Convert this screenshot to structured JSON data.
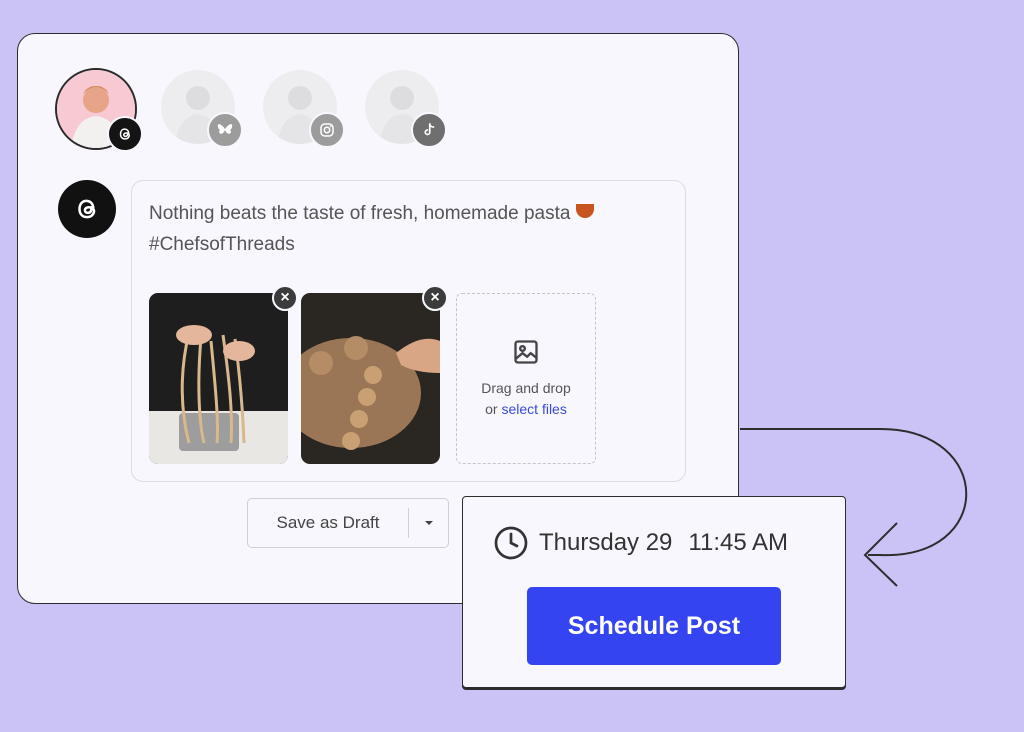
{
  "accounts": [
    {
      "name": "threads-account",
      "active": true,
      "badge": "threads-icon"
    },
    {
      "name": "bluesky-account",
      "active": false,
      "badge": "butterfly-icon"
    },
    {
      "name": "instagram-account",
      "active": false,
      "badge": "instagram-icon"
    },
    {
      "name": "tiktok-account",
      "active": false,
      "badge": "tiktok-icon"
    }
  ],
  "post": {
    "text_line1": "Nothing beats the taste of fresh, homemade pasta",
    "text_line2": "#ChefsofThreads"
  },
  "media": {
    "remove_label": "×",
    "dropzone": {
      "line1": "Drag and drop",
      "line2_prefix": "or ",
      "link": "select files"
    }
  },
  "draft": {
    "label": "Save as Draft"
  },
  "schedule": {
    "day": "Thursday 29",
    "time": "11:45 AM",
    "button_label": "Schedule Post"
  },
  "colors": {
    "background": "#cbc2f6",
    "primary": "#3344f0",
    "link": "#3a4bd6"
  }
}
